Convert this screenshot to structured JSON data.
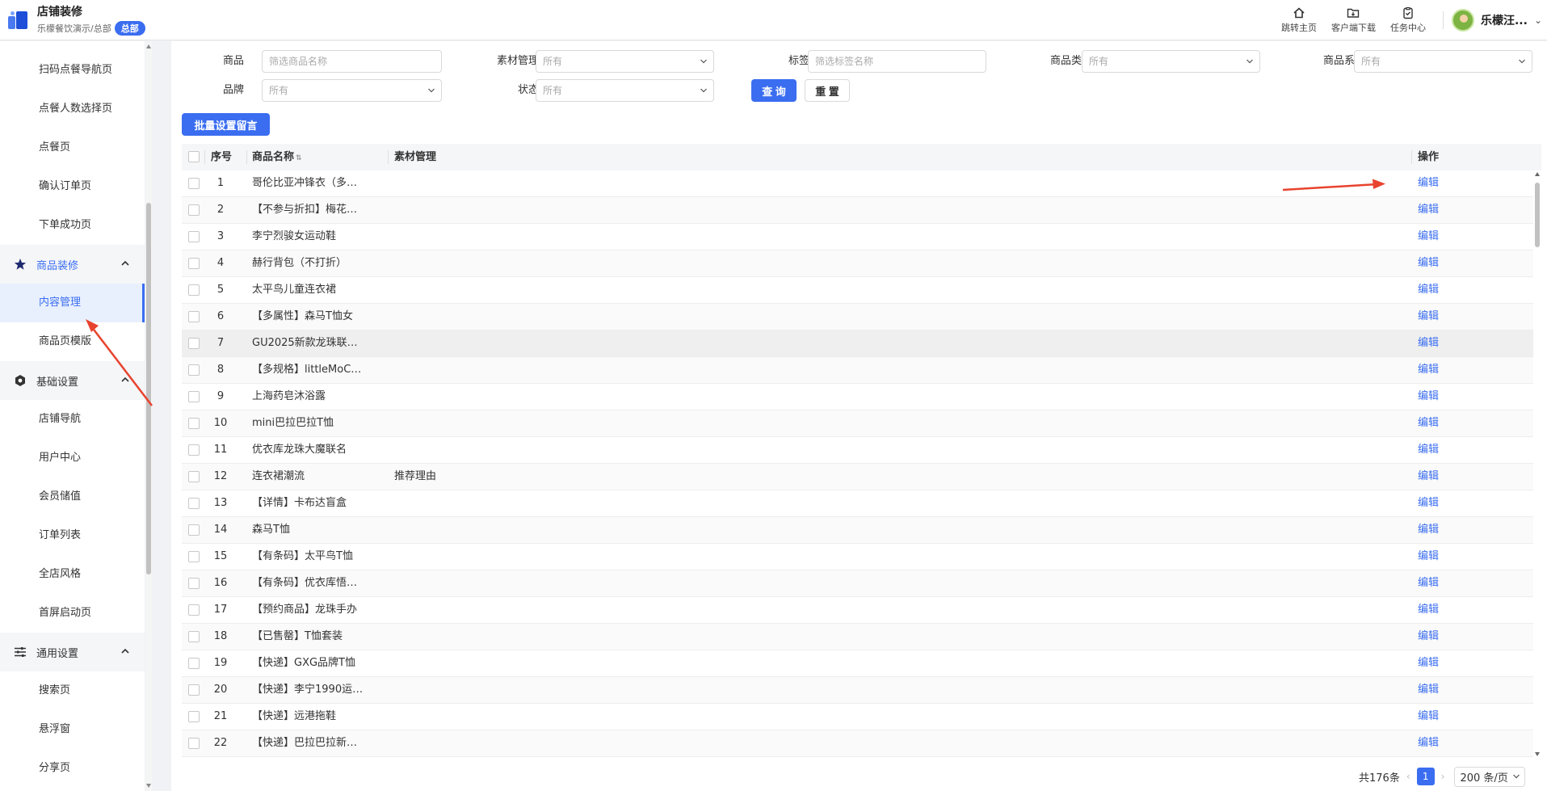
{
  "header": {
    "title": "店铺装修",
    "subtitle": "乐檬餐饮演示/总部",
    "badge": "总部",
    "actions": [
      {
        "label": "跳转主页",
        "icon": "home-icon"
      },
      {
        "label": "客户端下载",
        "icon": "folder-download-icon"
      },
      {
        "label": "任务中心",
        "icon": "clipboard-icon"
      }
    ],
    "user": "乐檬汪..."
  },
  "sidebar": {
    "items_top": [
      "扫码点餐导航页",
      "点餐人数选择页",
      "点餐页",
      "确认订单页",
      "下单成功页"
    ],
    "group_goods": "商品装修",
    "goods_items": [
      "内容管理",
      "商品页模版"
    ],
    "active_item": "内容管理",
    "group_basic": "基础设置",
    "basic_items": [
      "店铺导航",
      "用户中心",
      "会员储值",
      "订单列表",
      "全店风格",
      "首屏启动页"
    ],
    "group_general": "通用设置",
    "general_items": [
      "搜索页",
      "悬浮窗",
      "分享页"
    ]
  },
  "filters": {
    "goods_label": "商品",
    "goods_placeholder": "筛选商品名称",
    "material_label": "素材管理",
    "material_value": "所有",
    "tag_label": "标签",
    "tag_placeholder": "筛选标签名称",
    "category_label": "商品类别",
    "category_value": "所有",
    "series_label": "商品系列",
    "series_value": "所有",
    "brand_label": "品牌",
    "brand_value": "所有",
    "status_label": "状态",
    "status_value": "所有",
    "query_button": "查 询",
    "reset_button": "重 置",
    "batch_button": "批量设置留言"
  },
  "table": {
    "columns": {
      "index": "序号",
      "name": "商品名称",
      "material": "素材管理",
      "operation": "操作"
    },
    "edit_label": "编辑",
    "rows": [
      {
        "index": "1",
        "name": "哥伦比亚冲锋衣（多…",
        "material": ""
      },
      {
        "index": "2",
        "name": "【不参与折扣】梅花…",
        "material": ""
      },
      {
        "index": "3",
        "name": "李宁烈骏女运动鞋",
        "material": ""
      },
      {
        "index": "4",
        "name": "赫行背包（不打折）",
        "material": ""
      },
      {
        "index": "5",
        "name": "太平鸟儿童连衣裙",
        "material": ""
      },
      {
        "index": "6",
        "name": "【多属性】森马T恤女",
        "material": ""
      },
      {
        "index": "7",
        "name": "GU2025新款龙珠联…",
        "material": ""
      },
      {
        "index": "8",
        "name": "【多规格】littleMoC…",
        "material": ""
      },
      {
        "index": "9",
        "name": "上海药皂沐浴露",
        "material": ""
      },
      {
        "index": "10",
        "name": "mini巴拉巴拉T恤",
        "material": ""
      },
      {
        "index": "11",
        "name": "优衣库龙珠大魔联名",
        "material": ""
      },
      {
        "index": "12",
        "name": "连衣裙潮流",
        "material": "推荐理由"
      },
      {
        "index": "13",
        "name": "【详情】卡布达盲盒",
        "material": ""
      },
      {
        "index": "14",
        "name": "森马T恤",
        "material": ""
      },
      {
        "index": "15",
        "name": "【有条码】太平鸟T恤",
        "material": ""
      },
      {
        "index": "16",
        "name": "【有条码】优衣库悟…",
        "material": ""
      },
      {
        "index": "17",
        "name": "【预约商品】龙珠手办",
        "material": ""
      },
      {
        "index": "18",
        "name": "【已售罄】T恤套装",
        "material": ""
      },
      {
        "index": "19",
        "name": "【快递】GXG品牌T恤",
        "material": ""
      },
      {
        "index": "20",
        "name": "【快递】李宁1990运…",
        "material": ""
      },
      {
        "index": "21",
        "name": "【快递】远港拖鞋",
        "material": ""
      },
      {
        "index": "22",
        "name": "【快递】巴拉巴拉新…",
        "material": ""
      }
    ]
  },
  "pagination": {
    "total": "共176条",
    "current_page": "1",
    "page_size": "200 条/页"
  },
  "colors": {
    "accent": "#3a6df0",
    "annotation_arrow": "#e8432e"
  }
}
